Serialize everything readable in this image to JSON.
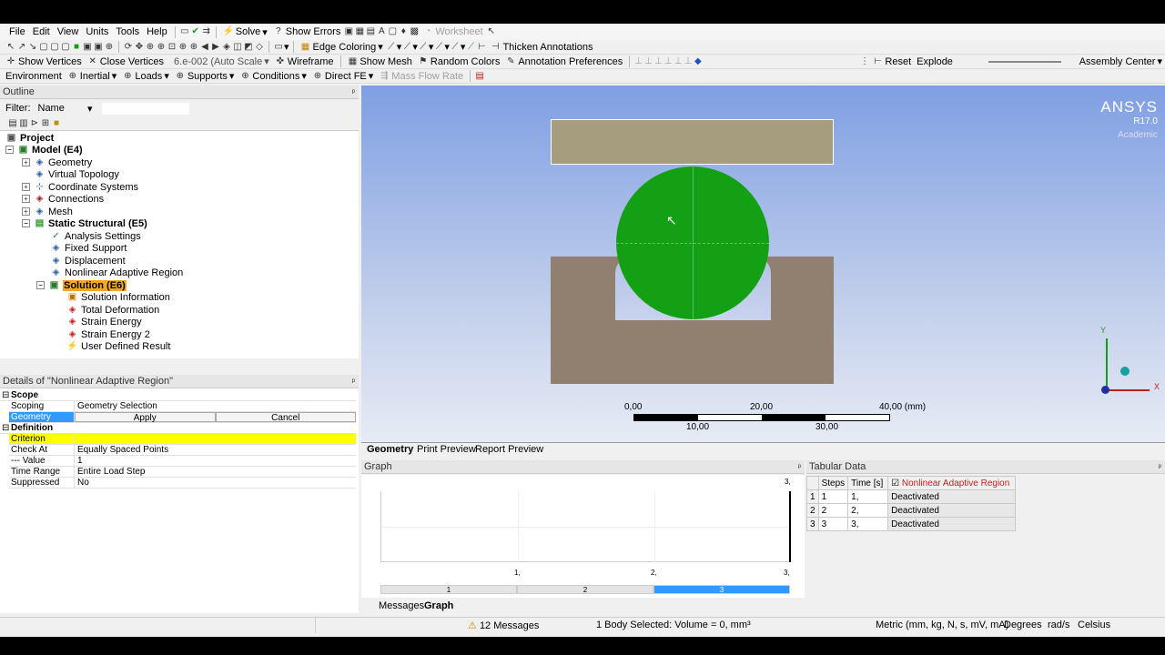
{
  "menu": [
    "File",
    "Edit",
    "View",
    "Units",
    "Tools",
    "Help"
  ],
  "toolbar1": {
    "solve": "Solve",
    "show_errors": "Show Errors",
    "worksheet": "Worksheet"
  },
  "toolbar2": {
    "edge_coloring": "Edge Coloring",
    "thicken": "Thicken Annotations"
  },
  "toolbar3": {
    "show_vertices": "Show Vertices",
    "close_vertices": "Close Vertices",
    "auto_scale": "6.e-002 (Auto Scale",
    "wireframe": "Wireframe",
    "show_mesh": "Show Mesh",
    "random_colors": "Random Colors",
    "annotation_prefs": "Annotation Preferences",
    "reset": "Reset",
    "explode": "Explode",
    "assembly_center": "Assembly Center"
  },
  "toolbar4": {
    "environment": "Environment",
    "inertial": "Inertial",
    "loads": "Loads",
    "supports": "Supports",
    "conditions": "Conditions",
    "direct_fe": "Direct FE",
    "mass_flow": "Mass Flow Rate"
  },
  "outline": {
    "title": "Outline",
    "filter_label": "Filter:",
    "filter_value": "Name",
    "items": [
      {
        "label": "Project",
        "level": 0
      },
      {
        "label": "Model (E4)",
        "level": 1
      },
      {
        "label": "Geometry",
        "level": 2
      },
      {
        "label": "Virtual Topology",
        "level": 2
      },
      {
        "label": "Coordinate Systems",
        "level": 2
      },
      {
        "label": "Connections",
        "level": 2
      },
      {
        "label": "Mesh",
        "level": 2
      },
      {
        "label": "Static Structural (E5)",
        "level": 2
      },
      {
        "label": "Analysis Settings",
        "level": 3
      },
      {
        "label": "Fixed Support",
        "level": 3
      },
      {
        "label": "Displacement",
        "level": 3
      },
      {
        "label": "Nonlinear Adaptive Region",
        "level": 3
      },
      {
        "label": "Solution (E6)",
        "level": 3
      },
      {
        "label": "Solution Information",
        "level": 4
      },
      {
        "label": "Total Deformation",
        "level": 4
      },
      {
        "label": "Strain Energy",
        "level": 4
      },
      {
        "label": "Strain Energy 2",
        "level": 4
      },
      {
        "label": "User Defined Result",
        "level": 4
      }
    ]
  },
  "details": {
    "title": "Details of \"Nonlinear Adaptive Region\"",
    "scope": "Scope",
    "scoping_method_k": "Scoping Method",
    "scoping_method_v": "Geometry Selection",
    "geometry_k": "Geometry",
    "apply": "Apply",
    "cancel": "Cancel",
    "definition": "Definition",
    "criterion_k": "Criterion",
    "check_at_k": "Check At",
    "check_at_v": "Equally Spaced Points",
    "value_k": "--- Value",
    "value_v": "1",
    "time_range_k": "Time Range",
    "time_range_v": "Entire Load Step",
    "suppressed_k": "Suppressed",
    "suppressed_v": "No"
  },
  "viewport": {
    "brand": "ANSYS",
    "version": "R17.0",
    "edition": "Academic",
    "scale_labels_top": [
      "0,00",
      "20,00",
      "40,00 (mm)"
    ],
    "scale_labels_bottom": [
      "10,00",
      "30,00"
    ],
    "axis_y": "Y",
    "axis_x": "X"
  },
  "view_tabs": [
    "Geometry",
    "Print Preview",
    "Report Preview"
  ],
  "graph": {
    "title": "Graph",
    "y_top": "3,",
    "x_ticks": [
      "1,",
      "2,",
      "3,"
    ],
    "steps": [
      "1",
      "2",
      "3"
    ]
  },
  "tabular": {
    "title": "Tabular Data",
    "headers": [
      "Steps",
      "Time [s]",
      "Nonlinear Adaptive Region"
    ],
    "rows": [
      [
        "1",
        "1",
        "1,",
        "Deactivated"
      ],
      [
        "2",
        "2",
        "2,",
        "Deactivated"
      ],
      [
        "3",
        "3",
        "3,",
        "Deactivated"
      ]
    ]
  },
  "bottom_tabs": [
    "Messages",
    "Graph"
  ],
  "status": {
    "messages": "12 Messages",
    "selection": "1 Body Selected: Volume = 0, mm³",
    "units": "Metric (mm, kg, N, s, mV, mA)",
    "degrees": "Degrees",
    "rads": "rad/s",
    "temp": "Celsius"
  },
  "colors": {
    "highlight": "#ffff00",
    "selected": "#3399ff",
    "ball": "#14a014",
    "body": "#917f70",
    "plate": "#a59d7e"
  }
}
